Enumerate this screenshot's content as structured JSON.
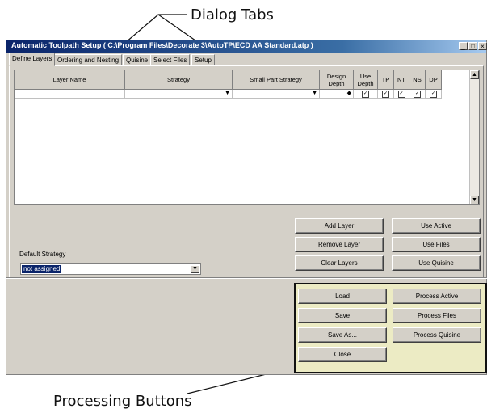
{
  "callouts": {
    "top": "Dialog Tabs",
    "bottom": "Processing Buttons"
  },
  "window": {
    "title": "Automatic Toolpath Setup ( C:\\Program Files\\Decorate 3\\AutoTP\\ECD AA Standard.atp )",
    "controls": [
      "_",
      "□",
      "×"
    ]
  },
  "tabs": [
    "Define Layers",
    "Ordering and Nesting",
    "Quisine",
    "Select Files",
    "Setup"
  ],
  "grid": {
    "columns": [
      "Layer Name",
      "Strategy",
      "Small Part Strategy",
      "Design Depth",
      "Use Depth",
      "TP",
      "NT",
      "NS",
      "DP"
    ]
  },
  "layer_buttons": {
    "add": "Add Layer",
    "remove": "Remove Layer",
    "clear": "Clear Layers"
  },
  "use_buttons": {
    "active": "Use Active",
    "files": "Use Files",
    "quisine": "Use Quisine"
  },
  "default_strategy": {
    "label": "Default Strategy",
    "value": "not assigned"
  },
  "file_buttons": {
    "load": "Load",
    "save": "Save",
    "save_as": "Save As...",
    "close": "Close"
  },
  "process_buttons": {
    "active": "Process Active",
    "files": "Process Files",
    "quisine": "Process Quisine"
  },
  "colors": {
    "title_bar": "#0a246a",
    "highlight_box": "#ecebc4",
    "dialog_face": "#d4d0c8"
  }
}
